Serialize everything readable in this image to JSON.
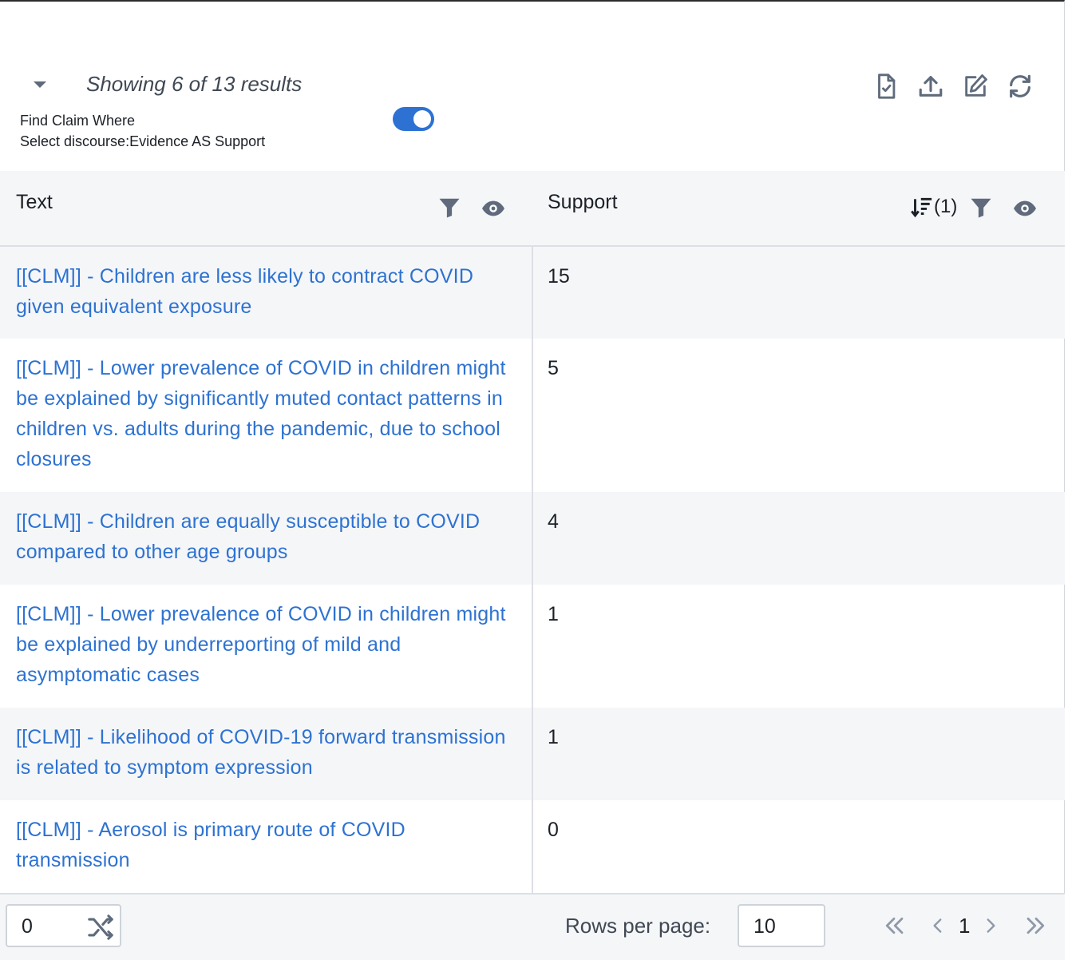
{
  "header": {
    "results_text": "Showing 6 of 13 results",
    "query_line1": "Find Claim Where",
    "query_line2": "Select discourse:Evidence AS Support",
    "toggle_on": true
  },
  "toolbar": {
    "icons": [
      "export-document-icon",
      "upload-icon",
      "edit-icon",
      "refresh-icon"
    ]
  },
  "table": {
    "columns": [
      {
        "label": "Text",
        "icons": [
          "filter-icon",
          "eye-icon"
        ]
      },
      {
        "label": "Support",
        "sort_label": "(1)",
        "icons": [
          "sort-descending-icon",
          "filter-icon",
          "eye-icon"
        ]
      }
    ],
    "rows": [
      {
        "text": "[[CLM]] - Children are less likely to contract COVID given equivalent exposure",
        "support": "15"
      },
      {
        "text": "[[CLM]] - Lower prevalence of COVID in children might be explained by significantly muted contact patterns in children vs. adults during the pandemic, due to school closures",
        "support": "5"
      },
      {
        "text": "[[CLM]] - Children are equally susceptible to COVID compared to other age groups",
        "support": "4"
      },
      {
        "text": "[[CLM]] - Lower prevalence of COVID in children might be explained by underreporting of mild and asymptomatic cases",
        "support": "1"
      },
      {
        "text": "[[CLM]] - Likelihood of COVID-19 forward transmission is related to symptom expression",
        "support": "1"
      },
      {
        "text": "[[CLM]] - Aerosol is primary route of COVID transmission",
        "support": "0"
      }
    ]
  },
  "footer": {
    "offset_value": "0",
    "rows_per_page_label": "Rows per page:",
    "rows_per_page_value": "10",
    "page_number": "1"
  },
  "colors": {
    "link": "#2d72d2",
    "toggle": "#2d72d2",
    "stripe": "#f5f6f8"
  }
}
